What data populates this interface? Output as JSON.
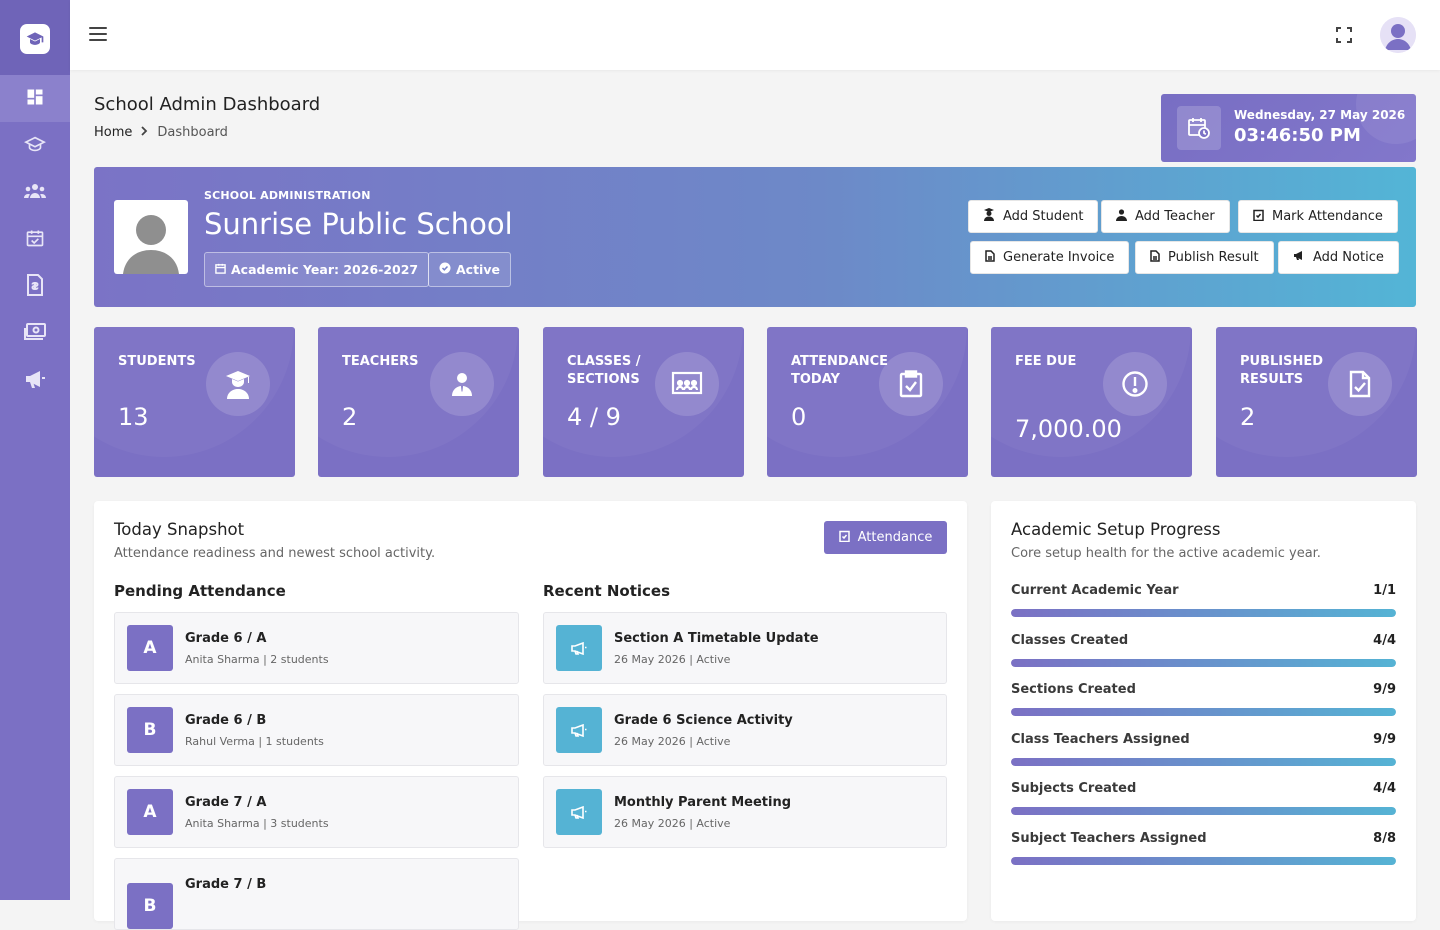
{
  "header": {
    "page_title": "School Admin Dashboard",
    "breadcrumb": {
      "home": "Home",
      "current": "Dashboard"
    },
    "clock": {
      "date": "Wednesday, 27 May 2026",
      "time": "03:46:50 PM"
    }
  },
  "sidebar": {
    "items": [
      {
        "icon": "dashboard-icon",
        "active": true
      },
      {
        "icon": "graduation-cap-icon"
      },
      {
        "icon": "users-icon"
      },
      {
        "icon": "calendar-check-icon"
      },
      {
        "icon": "invoice-icon"
      },
      {
        "icon": "money-icon"
      },
      {
        "icon": "megaphone-icon"
      }
    ]
  },
  "hero": {
    "eyebrow": "SCHOOL ADMINISTRATION",
    "school_name": "Sunrise Public School",
    "academic_year": "Academic Year: 2026-2027",
    "status": "Active",
    "buttons": {
      "add_student": "Add Student",
      "add_teacher": "Add Teacher",
      "mark_attendance": "Mark Attendance",
      "generate_invoice": "Generate Invoice",
      "publish_result": "Publish Result",
      "add_notice": "Add Notice"
    }
  },
  "stats": [
    {
      "label": "STUDENTS",
      "value": "13",
      "icon": "graduate-icon"
    },
    {
      "label": "TEACHERS",
      "value": "2",
      "icon": "teacher-icon"
    },
    {
      "label": "CLASSES / SECTIONS",
      "value": "4 / 9",
      "icon": "classroom-icon"
    },
    {
      "label": "ATTENDANCE TODAY",
      "value": "0",
      "icon": "clipboard-check-icon"
    },
    {
      "label": "FEE DUE",
      "value": "7,000.00",
      "icon": "alert-circle-icon"
    },
    {
      "label": "PUBLISHED RESULTS",
      "value": "2",
      "icon": "file-check-icon"
    }
  ],
  "snapshot": {
    "title": "Today Snapshot",
    "subtitle": "Attendance readiness and newest school activity.",
    "button": "Attendance",
    "pending_title": "Pending Attendance",
    "pending": [
      {
        "badge": "A",
        "title": "Grade 6 / A",
        "sub": "Anita Sharma | 2 students"
      },
      {
        "badge": "B",
        "title": "Grade 6 / B",
        "sub": "Rahul Verma | 1 students"
      },
      {
        "badge": "A",
        "title": "Grade 7 / A",
        "sub": "Anita Sharma | 3 students"
      },
      {
        "badge": "B",
        "title": "Grade 7 / B",
        "sub": ""
      }
    ],
    "notices_title": "Recent Notices",
    "notices": [
      {
        "title": "Section A Timetable Update",
        "sub": "26 May 2026 | Active"
      },
      {
        "title": "Grade 6 Science Activity",
        "sub": "26 May 2026 | Active"
      },
      {
        "title": "Monthly Parent Meeting",
        "sub": "26 May 2026 | Active"
      }
    ]
  },
  "academic": {
    "title": "Academic Setup Progress",
    "subtitle": "Core setup health for the active academic year.",
    "items": [
      {
        "label": "Current Academic Year",
        "value": "1/1",
        "progress": 1.0
      },
      {
        "label": "Classes Created",
        "value": "4/4",
        "progress": 1.0
      },
      {
        "label": "Sections Created",
        "value": "9/9",
        "progress": 1.0
      },
      {
        "label": "Class Teachers Assigned",
        "value": "9/9",
        "progress": 1.0
      },
      {
        "label": "Subjects Created",
        "value": "4/4",
        "progress": 1.0
      },
      {
        "label": "Subject Teachers Assigned",
        "value": "8/8",
        "progress": 1.0
      }
    ]
  },
  "colors": {
    "primary": "#7b70c4",
    "accent": "#55b3d4",
    "background": "#f4f4f4"
  }
}
